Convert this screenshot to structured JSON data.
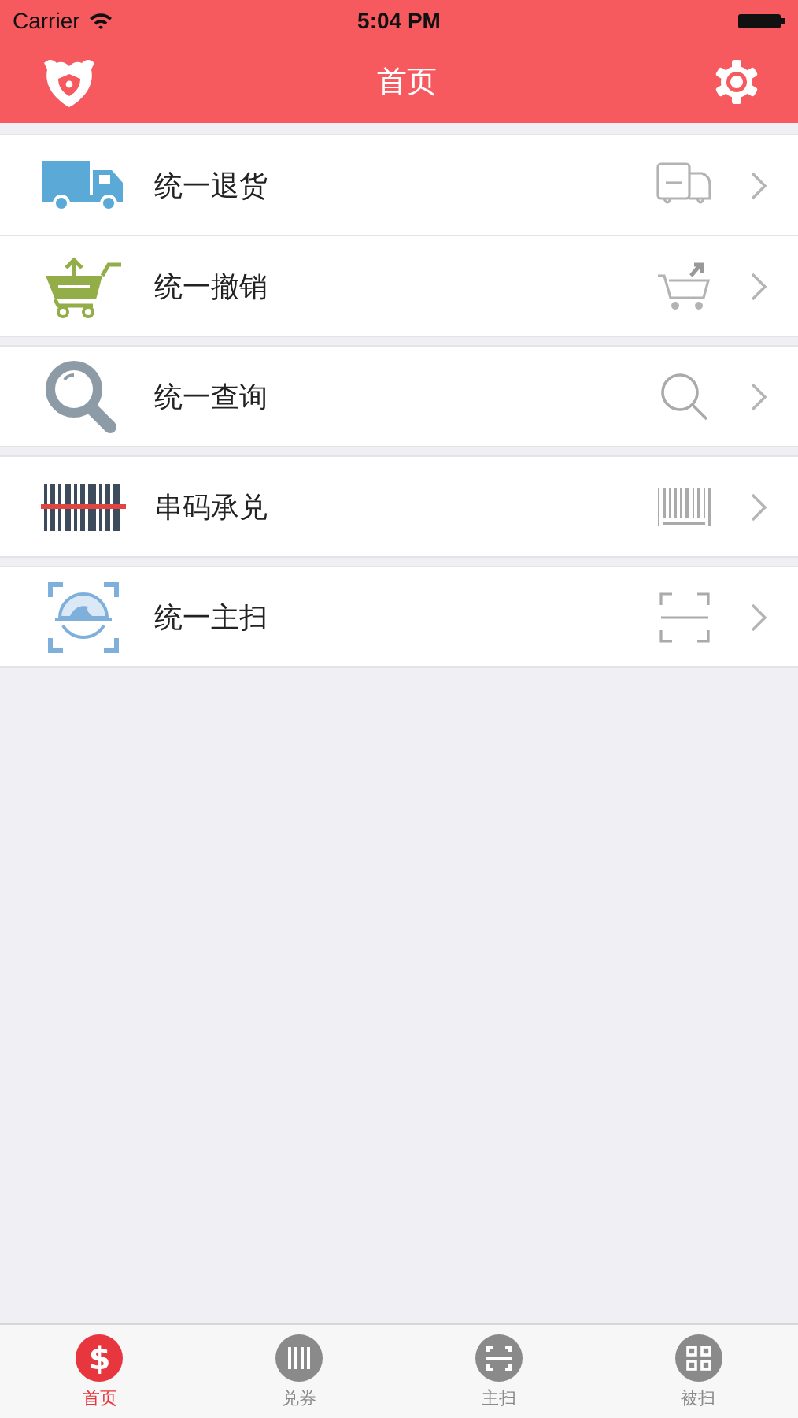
{
  "status_bar": {
    "carrier": "Carrier",
    "time": "5:04 PM"
  },
  "nav_bar": {
    "title": "首页"
  },
  "sections": [
    {
      "rows": [
        {
          "kind": "truck",
          "label": "统一退货"
        },
        {
          "kind": "cart",
          "label": "统一撤销"
        }
      ]
    },
    {
      "rows": [
        {
          "kind": "search",
          "label": "统一查询"
        }
      ]
    },
    {
      "rows": [
        {
          "kind": "barcode",
          "label": "串码承兑"
        }
      ]
    },
    {
      "rows": [
        {
          "kind": "scan",
          "label": "统一主扫"
        }
      ]
    }
  ],
  "tab_bar": [
    {
      "kind": "dollar",
      "glyph": "$",
      "label": "首页",
      "selected": true
    },
    {
      "kind": "coupon",
      "label": "兑券",
      "selected": false
    },
    {
      "kind": "scan",
      "label": "主扫",
      "selected": false
    },
    {
      "kind": "qr",
      "label": "被扫",
      "selected": false
    }
  ]
}
